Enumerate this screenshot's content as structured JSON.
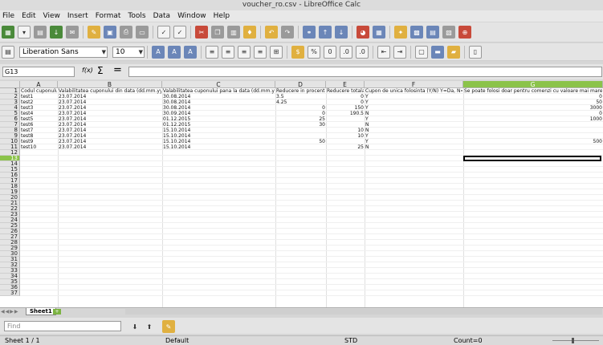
{
  "window": {
    "title": "voucher_ro.csv - LibreOffice Calc"
  },
  "menu": [
    "File",
    "Edit",
    "View",
    "Insert",
    "Format",
    "Tools",
    "Data",
    "Window",
    "Help"
  ],
  "toolbar2": {
    "font_name": "Liberation Sans",
    "font_size": "10"
  },
  "formula_bar": {
    "name_box": "G13",
    "fx": "f(x)",
    "sigma": "Σ",
    "equals": "="
  },
  "columns": [
    {
      "letter": "A"
    },
    {
      "letter": "B"
    },
    {
      "letter": "C"
    },
    {
      "letter": "D"
    },
    {
      "letter": "E"
    },
    {
      "letter": "F"
    },
    {
      "letter": "G"
    }
  ],
  "headers": [
    "Codul cuponului",
    "Valabilitatea cuponului din data (dd.mm.yyyy)",
    "Valabilitatea cuponului pana la data  (dd.mm.yyyy)",
    "Reducere in procente",
    "Reducere totala",
    "Cupon de unica folosinta (Y/N) Y=Da, N=Nu",
    "Se poate folosi doar pentru comenzi cu valoare mai mare de"
  ],
  "rows": [
    {
      "A": "test1",
      "B": "23.07.2014",
      "C": "30.08.2014",
      "D": "3.5",
      "E": "0",
      "F": "Y",
      "G": "0"
    },
    {
      "A": "test2",
      "B": "23.07.2014",
      "C": "30.08.2014",
      "D": "4.25",
      "E": "0",
      "F": "Y",
      "G": "50"
    },
    {
      "A": "test3",
      "B": "23.07.2014",
      "C": "30.08.2014",
      "D": "0",
      "E": "150",
      "F": "Y",
      "G": "3000"
    },
    {
      "A": "test4",
      "B": "23.07.2014",
      "C": "30.09.2014",
      "D": "0",
      "E": "190.5",
      "F": "N",
      "G": "0"
    },
    {
      "A": "test5",
      "B": "23.07.2014",
      "C": "01.12.2015",
      "D": "25",
      "E": "",
      "F": "Y",
      "G": "1000"
    },
    {
      "A": "test6",
      "B": "23.07.2014",
      "C": "01.12.2015",
      "D": "30",
      "E": "",
      "F": "N",
      "G": ""
    },
    {
      "A": "test7",
      "B": "23.07.2014",
      "C": "15.10.2014",
      "D": "",
      "E": "10",
      "F": "N",
      "G": ""
    },
    {
      "A": "test8",
      "B": "23.07.2014",
      "C": "15.10.2014",
      "D": "",
      "E": "10",
      "F": "Y",
      "G": ""
    },
    {
      "A": "test9",
      "B": "23.07.2014",
      "C": "15.10.2014",
      "D": "50",
      "E": "",
      "F": "Y",
      "G": "500"
    },
    {
      "A": "test10",
      "B": "23.07.2014",
      "C": "15.10.2014",
      "D": "",
      "E": "25",
      "F": "N",
      "G": ""
    }
  ],
  "row_numbers": [
    "1",
    "2",
    "3",
    "4",
    "5",
    "6",
    "7",
    "8",
    "9",
    "10",
    "11",
    "12",
    "13",
    "14",
    "15",
    "16",
    "17",
    "18",
    "19",
    "20",
    "21",
    "22",
    "23",
    "24",
    "25",
    "26",
    "27",
    "28",
    "29",
    "30",
    "31",
    "32",
    "33",
    "34",
    "35",
    "36",
    "37"
  ],
  "sheet_tab": "Sheet1",
  "find": {
    "placeholder": "Find"
  },
  "status": {
    "sheet": "Sheet 1 / 1",
    "style": "Default",
    "mode": "STD",
    "count": "Count=0"
  }
}
